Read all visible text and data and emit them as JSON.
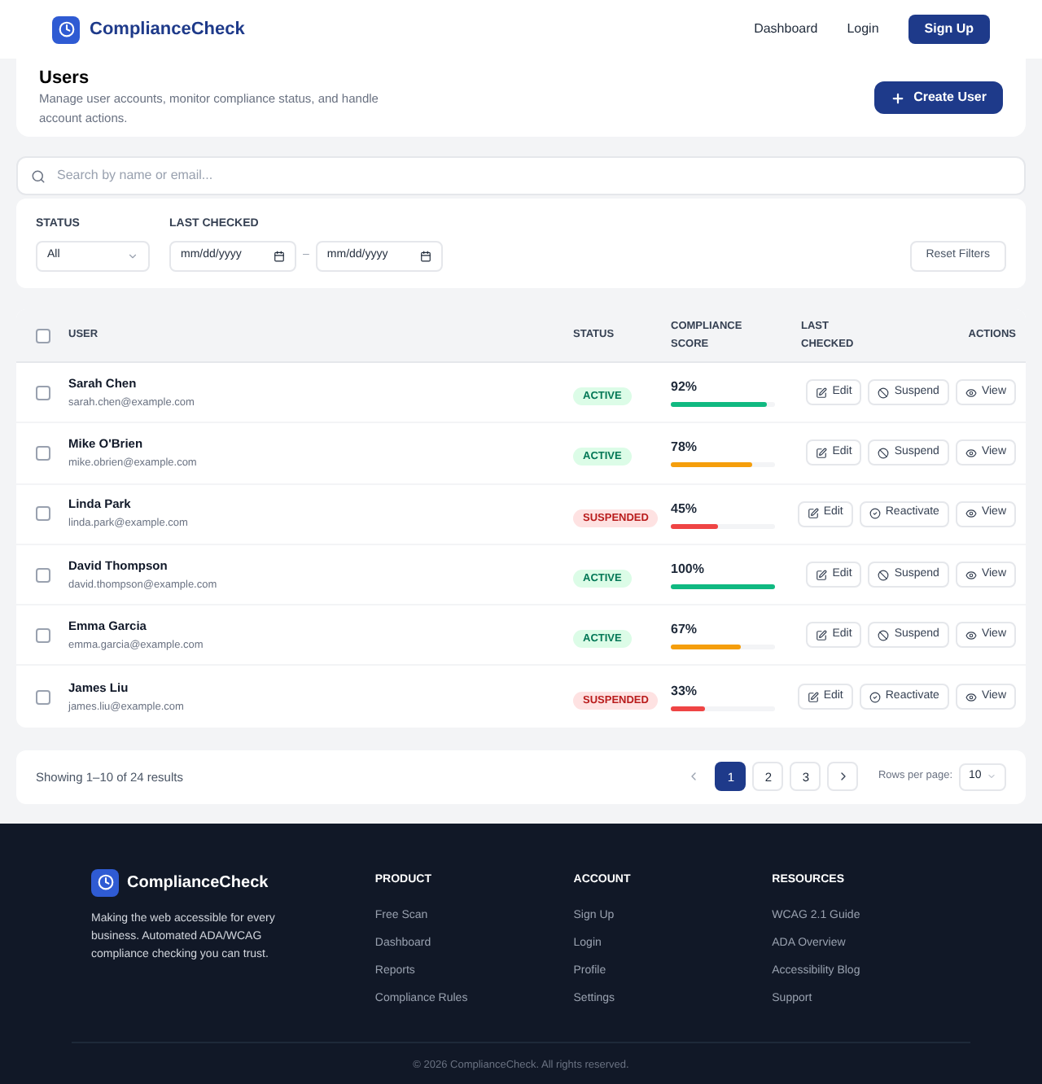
{
  "header": {
    "brand": "ComplianceCheck",
    "nav": [
      {
        "label": "Dashboard",
        "kind": "link"
      },
      {
        "label": "Login",
        "kind": "link"
      },
      {
        "label": "Sign Up",
        "kind": "primary"
      }
    ]
  },
  "page": {
    "title": "Users",
    "subtitle": "Manage user accounts, monitor compliance status, and handle account actions.",
    "create_button": "Create User"
  },
  "search": {
    "placeholder": "Search by name or email..."
  },
  "filters": {
    "status_label": "STATUS",
    "status_value": "All",
    "last_checked_label": "LAST CHECKED",
    "date_from": "mm/dd/yyyy",
    "separator": "–",
    "date_to": "mm/dd/yyyy",
    "reset_button": "Reset Filters"
  },
  "table": {
    "select_all": {
      "checked": false
    },
    "columns": [
      "USER",
      "STATUS",
      "COMPLIANCE SCORE",
      "LAST CHECKED",
      "ACTIONS"
    ],
    "rows": [
      {
        "checked": false,
        "name": "Sarah Chen",
        "email": "sarah.chen@example.com",
        "status": "ACTIVE",
        "kind": "active",
        "score": "92%",
        "level": 0.92,
        "color": "#10b981",
        "actions": [
          {
            "label": "Edit",
            "kind": "edit"
          },
          {
            "label": "Suspend",
            "kind": "suspend"
          },
          {
            "label": "View",
            "kind": "view"
          }
        ]
      },
      {
        "checked": false,
        "name": "Mike O'Brien",
        "email": "mike.obrien@example.com",
        "status": "ACTIVE",
        "kind": "active",
        "score": "78%",
        "level": 0.78,
        "color": "#f59e0b",
        "actions": [
          {
            "label": "Edit",
            "kind": "edit"
          },
          {
            "label": "Suspend",
            "kind": "suspend"
          },
          {
            "label": "View",
            "kind": "view"
          }
        ]
      },
      {
        "checked": false,
        "name": "Linda Park",
        "email": "linda.park@example.com",
        "status": "SUSPENDED",
        "kind": "suspended",
        "score": "45%",
        "level": 0.45,
        "color": "#ef4444",
        "actions": [
          {
            "label": "Edit",
            "kind": "edit"
          },
          {
            "label": "Reactivate",
            "kind": "reactivate"
          },
          {
            "label": "View",
            "kind": "view"
          }
        ]
      },
      {
        "checked": false,
        "name": "David Thompson",
        "email": "david.thompson@example.com",
        "status": "ACTIVE",
        "kind": "active",
        "score": "100%",
        "level": 1,
        "color": "#10b981",
        "actions": [
          {
            "label": "Edit",
            "kind": "edit"
          },
          {
            "label": "Suspend",
            "kind": "suspend"
          },
          {
            "label": "View",
            "kind": "view"
          }
        ]
      },
      {
        "checked": false,
        "name": "Emma Garcia",
        "email": "emma.garcia@example.com",
        "status": "ACTIVE",
        "kind": "active",
        "score": "67%",
        "level": 0.67,
        "color": "#f59e0b",
        "actions": [
          {
            "label": "Edit",
            "kind": "edit"
          },
          {
            "label": "Suspend",
            "kind": "suspend"
          },
          {
            "label": "View",
            "kind": "view"
          }
        ]
      },
      {
        "checked": false,
        "name": "James Liu",
        "email": "james.liu@example.com",
        "status": "SUSPENDED",
        "kind": "suspended",
        "score": "33%",
        "level": 0.33,
        "color": "#ef4444",
        "actions": [
          {
            "label": "Edit",
            "kind": "edit"
          },
          {
            "label": "Reactivate",
            "kind": "reactivate"
          },
          {
            "label": "View",
            "kind": "view"
          }
        ]
      }
    ]
  },
  "pagination": {
    "summary": "Showing 1–10 of 24 results",
    "pages": [
      {
        "label": "1",
        "selected": true
      },
      {
        "label": "2",
        "selected": false
      },
      {
        "label": "3",
        "selected": false
      }
    ],
    "rows_label": "Rows per page:",
    "rows_value": "10"
  },
  "footer": {
    "brand": "ComplianceCheck",
    "tagline": "Making the web accessible for every business. Automated ADA/WCAG compliance checking you can trust.",
    "columns": [
      {
        "title": "PRODUCT",
        "links": [
          "Free Scan",
          "Dashboard",
          "Reports",
          "Compliance Rules"
        ]
      },
      {
        "title": "ACCOUNT",
        "links": [
          "Sign Up",
          "Login",
          "Profile",
          "Settings"
        ]
      },
      {
        "title": "RESOURCES",
        "links": [
          "WCAG 2.1 Guide",
          "ADA Overview",
          "Accessibility Blog",
          "Support"
        ]
      }
    ],
    "copyright": "© 2026 ComplianceCheck. All rights reserved."
  }
}
